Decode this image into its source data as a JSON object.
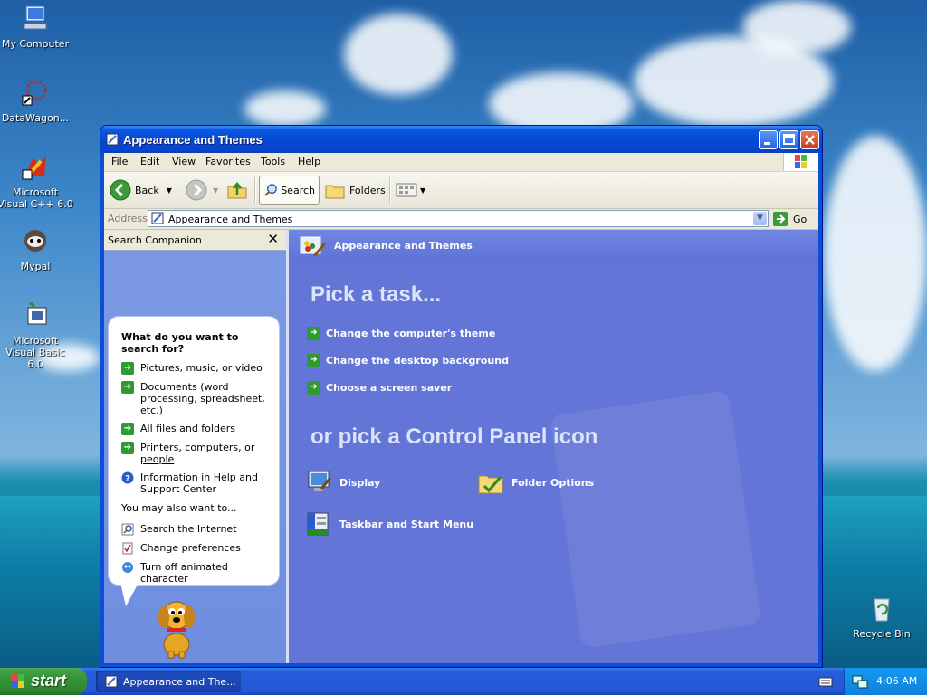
{
  "desktop": {
    "icons": [
      {
        "label": "My Computer",
        "icon": "my-computer-icon"
      },
      {
        "label": "DataWagon...",
        "icon": "datawagon-icon"
      },
      {
        "label": "Microsoft Visual C++ 6.0",
        "icon": "visual-cpp-icon"
      },
      {
        "label": "Mypal",
        "icon": "mypal-icon"
      },
      {
        "label": "Microsoft Visual Basic 6.0",
        "icon": "visual-basic-icon"
      },
      {
        "label": "Recycle Bin",
        "icon": "recycle-bin-icon"
      }
    ]
  },
  "window": {
    "title": "Appearance and Themes",
    "menu": [
      "File",
      "Edit",
      "View",
      "Favorites",
      "Tools",
      "Help"
    ],
    "toolbar": {
      "back": "Back",
      "search": "Search",
      "folders": "Folders"
    },
    "address": {
      "label": "Address",
      "value": "Appearance and Themes",
      "go": "Go"
    }
  },
  "companion": {
    "title": "Search Companion",
    "question": "What do you want to search for?",
    "options": [
      "Pictures, music, or video",
      "Documents (word processing, spreadsheet, etc.)",
      "All files and folders",
      "Printers, computers, or people",
      "Information in Help and Support Center"
    ],
    "also_label": "You may also want to...",
    "also": [
      "Search the Internet",
      "Change preferences",
      "Turn off animated character"
    ]
  },
  "content": {
    "header": "Appearance and Themes",
    "pick_task": "Pick a task...",
    "tasks": [
      "Change the computer's theme",
      "Change the desktop background",
      "Choose a screen saver"
    ],
    "pick_icon": "or pick a Control Panel icon",
    "icons": [
      {
        "label": "Display",
        "icon": "display-icon"
      },
      {
        "label": "Folder Options",
        "icon": "folder-options-icon"
      },
      {
        "label": "Taskbar and Start Menu",
        "icon": "taskbar-start-menu-icon"
      }
    ]
  },
  "taskbar": {
    "start": "start",
    "task_button": "Appearance and The...",
    "clock": "4:06 AM"
  }
}
